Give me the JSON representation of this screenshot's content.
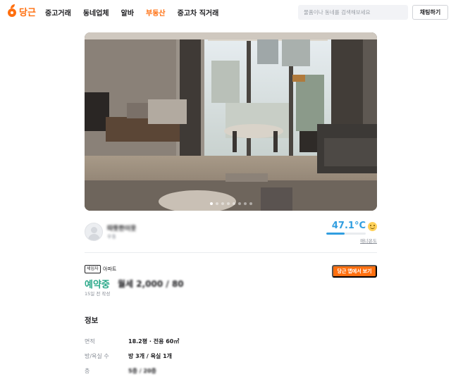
{
  "header": {
    "logo_text": "당근",
    "nav": [
      {
        "label": "중고거래",
        "active": false
      },
      {
        "label": "동네업체",
        "active": false
      },
      {
        "label": "알바",
        "active": false
      },
      {
        "label": "부동산",
        "active": true
      },
      {
        "label": "중고차 직거래",
        "active": false
      }
    ],
    "search_placeholder": "물품이나 동네를 검색해보세요",
    "chat_button": "채팅하기"
  },
  "photo": {
    "slide_count": 8,
    "active_slide": 1
  },
  "seller": {
    "name": "따뜻한이웃",
    "region": "우동",
    "manner_temp": "47.1°C",
    "manner_label": "매너온도",
    "manner_level_percent": 47.1,
    "face_icon": "smile-face-icon"
  },
  "listing": {
    "owner_badge": "세입자",
    "property_type": "아파트",
    "status": "예약중",
    "price": "월세 2,000 / 80",
    "posted": "15일 전 작성",
    "app_button": "당근 앱에서 보기"
  },
  "info": {
    "title": "정보",
    "rows": [
      {
        "label": "면적",
        "value": "18.2평 · 전용 60㎡",
        "blurred": false
      },
      {
        "label": "방/욕실 수",
        "value": "방 3개 / 욕실 1개",
        "blurred": false
      },
      {
        "label": "층",
        "value": "5층 / 20층",
        "blurred": true
      }
    ]
  },
  "colors": {
    "brand": "#ff6f0f",
    "status_green": "#2aa889",
    "manner_blue": "#319ee0"
  }
}
